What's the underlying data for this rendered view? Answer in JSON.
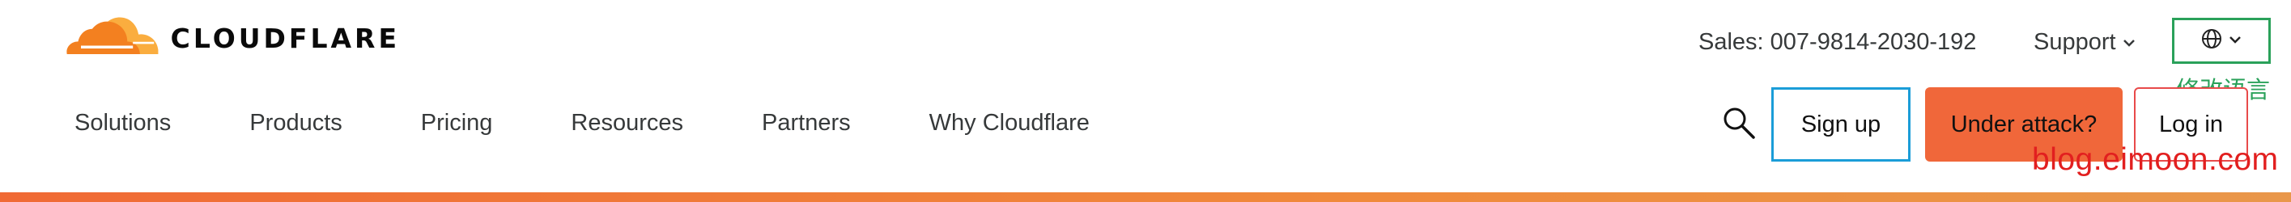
{
  "brand": {
    "name": "CLOUDFLARE"
  },
  "topbar": {
    "sales": "Sales: 007-9814-2030-192",
    "support": "Support",
    "language_annotation": "修改语言"
  },
  "nav": {
    "items": [
      "Solutions",
      "Products",
      "Pricing",
      "Resources",
      "Partners",
      "Why Cloudflare"
    ]
  },
  "actions": {
    "signup": "Sign up",
    "under_attack": "Under attack?",
    "login": "Log in"
  },
  "watermark": "blog.eimoon.com",
  "icons": {
    "logo": "cloudflare-cloud-logo",
    "support_chevron": "chevron-down-icon",
    "language": "globe-icon",
    "language_chevron": "chevron-down-icon",
    "search": "search-icon"
  },
  "colors": {
    "brand_orange": "#f38020",
    "under_attack_bg": "#f0673a",
    "signup_border": "#1b9dd8",
    "language_border": "#2aa15a",
    "login_border": "#e84a4a",
    "watermark": "#e21f1f"
  }
}
